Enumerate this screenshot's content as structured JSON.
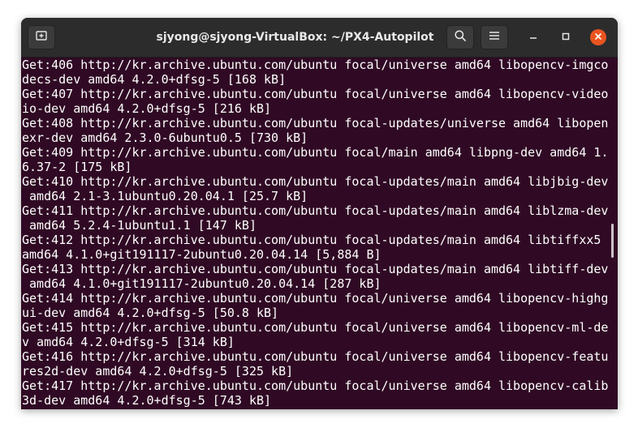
{
  "window": {
    "title": "sjyong@sjyong-VirtualBox: ~/PX4-Autopilot"
  },
  "titlebar": {
    "new_tab_icon": "new-tab-icon",
    "search_icon": "search-icon",
    "menu_icon": "hamburger-menu-icon",
    "minimize_icon": "minimize-icon",
    "maximize_icon": "maximize-icon",
    "close_icon": "close-icon"
  },
  "colors": {
    "terminal_bg": "#300a24",
    "titlebar_bg": "#2c2c2c",
    "close_button": "#e95420",
    "text": "#ffffff"
  },
  "terminal": {
    "lines": [
      "Get:406 http://kr.archive.ubuntu.com/ubuntu focal/universe amd64 libopencv-imgco",
      "decs-dev amd64 4.2.0+dfsg-5 [168 kB]",
      "Get:407 http://kr.archive.ubuntu.com/ubuntu focal/universe amd64 libopencv-video",
      "io-dev amd64 4.2.0+dfsg-5 [216 kB]",
      "Get:408 http://kr.archive.ubuntu.com/ubuntu focal-updates/universe amd64 libopen",
      "exr-dev amd64 2.3.0-6ubuntu0.5 [730 kB]",
      "Get:409 http://kr.archive.ubuntu.com/ubuntu focal/main amd64 libpng-dev amd64 1.",
      "6.37-2 [175 kB]",
      "Get:410 http://kr.archive.ubuntu.com/ubuntu focal-updates/main amd64 libjbig-dev",
      " amd64 2.1-3.1ubuntu0.20.04.1 [25.7 kB]",
      "Get:411 http://kr.archive.ubuntu.com/ubuntu focal-updates/main amd64 liblzma-dev",
      " amd64 5.2.4-1ubuntu1.1 [147 kB]",
      "Get:412 http://kr.archive.ubuntu.com/ubuntu focal-updates/main amd64 libtiffxx5",
      "amd64 4.1.0+git191117-2ubuntu0.20.04.14 [5,884 B]",
      "Get:413 http://kr.archive.ubuntu.com/ubuntu focal-updates/main amd64 libtiff-dev",
      " amd64 4.1.0+git191117-2ubuntu0.20.04.14 [287 kB]",
      "Get:414 http://kr.archive.ubuntu.com/ubuntu focal/universe amd64 libopencv-highg",
      "ui-dev amd64 4.2.0+dfsg-5 [50.8 kB]",
      "Get:415 http://kr.archive.ubuntu.com/ubuntu focal/universe amd64 libopencv-ml-de",
      "v amd64 4.2.0+dfsg-5 [314 kB]",
      "Get:416 http://kr.archive.ubuntu.com/ubuntu focal/universe amd64 libopencv-featu",
      "res2d-dev amd64 4.2.0+dfsg-5 [325 kB]",
      "Get:417 http://kr.archive.ubuntu.com/ubuntu focal/universe amd64 libopencv-calib",
      "3d-dev amd64 4.2.0+dfsg-5 [743 kB]"
    ]
  }
}
